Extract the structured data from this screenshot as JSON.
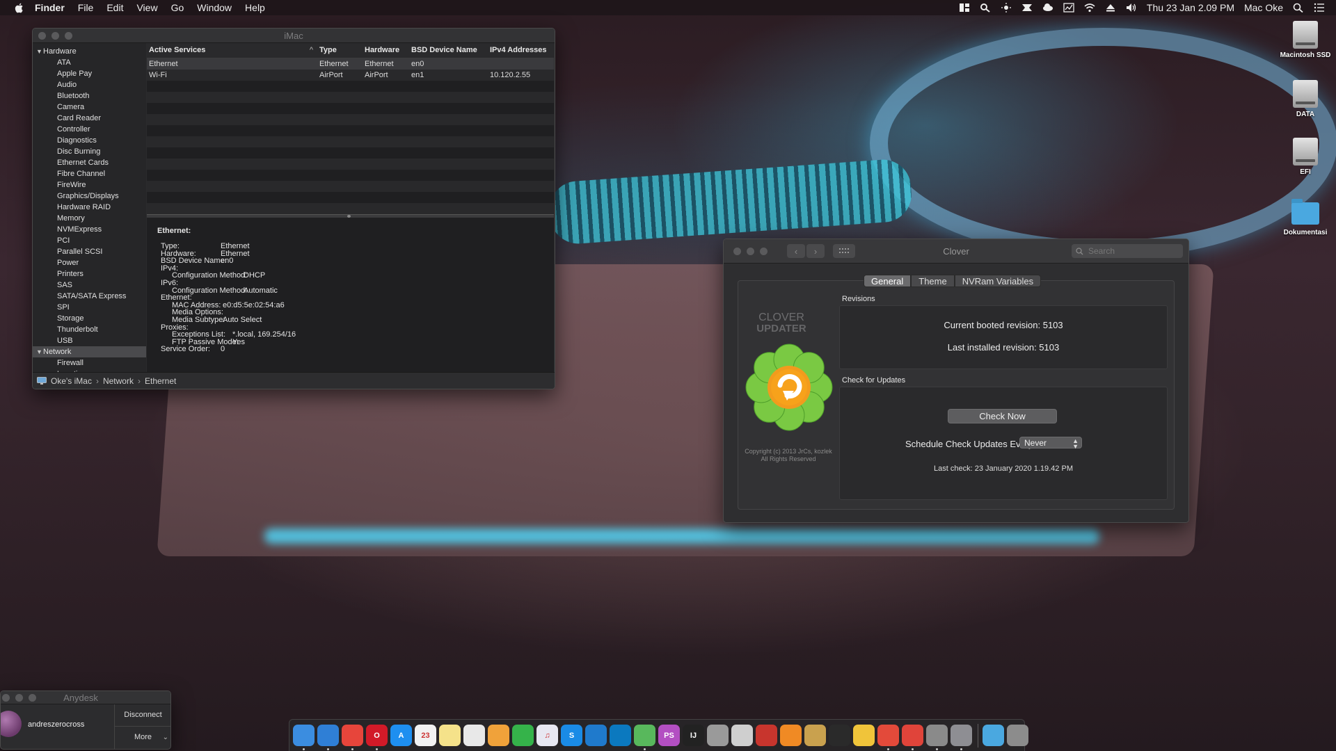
{
  "menubar": {
    "app_name": "Finder",
    "menus": [
      "File",
      "Edit",
      "View",
      "Go",
      "Window",
      "Help"
    ],
    "status_icons": [
      "layout-icon",
      "search-status-icon",
      "brightness-icon",
      "airplay-icon",
      "cloud-icon",
      "activity-icon",
      "wifi-icon",
      "eject-icon",
      "volume-icon"
    ],
    "datetime": "Thu 23 Jan  2.09 PM",
    "user": "Mac Oke",
    "right_icons": [
      "spotlight-icon",
      "notification-center-icon"
    ]
  },
  "sysinfo": {
    "title": "iMac",
    "sidebar": [
      {
        "label": "Hardware",
        "type": "cat"
      },
      {
        "label": "ATA",
        "type": "sub"
      },
      {
        "label": "Apple Pay",
        "type": "sub"
      },
      {
        "label": "Audio",
        "type": "sub"
      },
      {
        "label": "Bluetooth",
        "type": "sub"
      },
      {
        "label": "Camera",
        "type": "sub"
      },
      {
        "label": "Card Reader",
        "type": "sub"
      },
      {
        "label": "Controller",
        "type": "sub"
      },
      {
        "label": "Diagnostics",
        "type": "sub"
      },
      {
        "label": "Disc Burning",
        "type": "sub"
      },
      {
        "label": "Ethernet Cards",
        "type": "sub"
      },
      {
        "label": "Fibre Channel",
        "type": "sub"
      },
      {
        "label": "FireWire",
        "type": "sub"
      },
      {
        "label": "Graphics/Displays",
        "type": "sub"
      },
      {
        "label": "Hardware RAID",
        "type": "sub"
      },
      {
        "label": "Memory",
        "type": "sub"
      },
      {
        "label": "NVMExpress",
        "type": "sub"
      },
      {
        "label": "PCI",
        "type": "sub"
      },
      {
        "label": "Parallel SCSI",
        "type": "sub"
      },
      {
        "label": "Power",
        "type": "sub"
      },
      {
        "label": "Printers",
        "type": "sub"
      },
      {
        "label": "SAS",
        "type": "sub"
      },
      {
        "label": "SATA/SATA Express",
        "type": "sub"
      },
      {
        "label": "SPI",
        "type": "sub"
      },
      {
        "label": "Storage",
        "type": "sub"
      },
      {
        "label": "Thunderbolt",
        "type": "sub"
      },
      {
        "label": "USB",
        "type": "sub"
      },
      {
        "label": "Network",
        "type": "cat",
        "selected": true
      },
      {
        "label": "Firewall",
        "type": "sub"
      },
      {
        "label": "Locations",
        "type": "sub"
      }
    ],
    "table": {
      "columns": [
        "Active Services",
        "Type",
        "Hardware",
        "BSD Device Name",
        "IPv4 Addresses"
      ],
      "rows": [
        [
          "Ethernet",
          "Ethernet",
          "Ethernet",
          "en0",
          ""
        ],
        [
          "Wi-Fi",
          "AirPort",
          "AirPort",
          "en1",
          "10.120.2.55"
        ]
      ]
    },
    "detail": {
      "title": "Ethernet:",
      "lines": [
        {
          "label": "Type:",
          "value": "Ethernet",
          "indent": 0
        },
        {
          "label": "Hardware:",
          "value": "Ethernet",
          "indent": 0
        },
        {
          "label": "BSD Device Name:",
          "value": "en0",
          "indent": 0
        },
        {
          "label": "IPv4:",
          "value": "",
          "indent": 0
        },
        {
          "label": "Configuration Method:",
          "value": "DHCP",
          "indent": 1
        },
        {
          "label": "IPv6:",
          "value": "",
          "indent": 0
        },
        {
          "label": "Configuration Method:",
          "value": "Automatic",
          "indent": 1
        },
        {
          "label": "Ethernet:",
          "value": "",
          "indent": 0
        },
        {
          "label": "MAC Address:",
          "value": "e0:d5:5e:02:54:a6",
          "indent": 1
        },
        {
          "label": "Media Options:",
          "value": "",
          "indent": 1
        },
        {
          "label": "Media Subtype:",
          "value": "Auto Select",
          "indent": 1
        },
        {
          "label": "Proxies:",
          "value": "",
          "indent": 0
        },
        {
          "label": "Exceptions List:",
          "value": "*.local, 169.254/16",
          "indent": 1
        },
        {
          "label": "FTP Passive Mode:",
          "value": "Yes",
          "indent": 1
        },
        {
          "label": "Service Order:",
          "value": "0",
          "indent": 0
        }
      ]
    },
    "path": [
      "Oke's iMac",
      "Network",
      "Ethernet"
    ],
    "path_separator": "›"
  },
  "clover": {
    "title": "Clover",
    "search_placeholder": "Search",
    "tabs": [
      "General",
      "Theme",
      "NVRam Variables"
    ],
    "active_tab": "General",
    "logo_line1": "CLOVER",
    "logo_line2": "UPDATER",
    "copyright_line1": "Copyright (c) 2013 JrCs, kozlek",
    "copyright_line2": "All Rights Reserved",
    "revisions_label": "Revisions",
    "current_booted": "Current booted revision:  5103",
    "last_installed": "Last installed revision:  5103",
    "updates_label": "Check for Updates",
    "check_now": "Check Now",
    "schedule_label": "Schedule Check Updates Every:",
    "schedule_value": "Never",
    "last_check": "Last check: 23 January 2020 1.19.42 PM",
    "colors": {
      "flower": "#7ac943",
      "center": "#f7a21b"
    }
  },
  "desktop": {
    "icons": [
      {
        "label": "Macintosh SSD",
        "kind": "drive"
      },
      {
        "label": "DATA",
        "kind": "drive"
      },
      {
        "label": "EFI",
        "kind": "drive"
      },
      {
        "label": "Dokumentasi",
        "kind": "folder"
      }
    ]
  },
  "anydesk": {
    "title": "Anydesk",
    "user": "andreszerocross",
    "disconnect": "Disconnect",
    "more": "More"
  },
  "dock": {
    "items": [
      {
        "name": "finder-icon",
        "color": "#3b8de0",
        "glyph": "",
        "running": true
      },
      {
        "name": "safari-icon",
        "color": "#2f7fd6",
        "glyph": "",
        "running": true
      },
      {
        "name": "chrome-icon",
        "color": "#e7453b",
        "glyph": "",
        "running": true
      },
      {
        "name": "opera-icon",
        "color": "#d21a28",
        "glyph": "O",
        "running": true
      },
      {
        "name": "app-store-icon",
        "color": "#1e8ff0",
        "glyph": "A",
        "running": false
      },
      {
        "name": "calendar-icon",
        "color": "#f2f2f2",
        "glyph": "23",
        "running": false
      },
      {
        "name": "notes-icon",
        "color": "#f5e28a",
        "glyph": "",
        "running": false
      },
      {
        "name": "textedit-icon",
        "color": "#e8e8e8",
        "glyph": "",
        "running": false
      },
      {
        "name": "photos-icon",
        "color": "#f0a23a",
        "glyph": "",
        "running": false
      },
      {
        "name": "evernote-icon",
        "color": "#35b34a",
        "glyph": "",
        "running": false
      },
      {
        "name": "itunes-icon",
        "color": "#e8e8f2",
        "glyph": "♫",
        "running": false
      },
      {
        "name": "shazam-icon",
        "color": "#1a8be6",
        "glyph": "S",
        "running": false
      },
      {
        "name": "vscode-icon",
        "color": "#1f7acc",
        "glyph": "",
        "running": false
      },
      {
        "name": "trello-icon",
        "color": "#0b79bf",
        "glyph": "",
        "running": false
      },
      {
        "name": "android-studio-icon",
        "color": "#58b85c",
        "glyph": "",
        "running": true
      },
      {
        "name": "phpstorm-icon",
        "color": "#b34fc2",
        "glyph": "PS",
        "running": false
      },
      {
        "name": "intellij-icon",
        "color": "#222222",
        "glyph": "IJ",
        "running": false
      },
      {
        "name": "database-icon",
        "color": "#9a9a9a",
        "glyph": "",
        "running": false
      },
      {
        "name": "sequel-pro-icon",
        "color": "#cfcfcf",
        "glyph": "",
        "running": false
      },
      {
        "name": "photo-booth-icon",
        "color": "#c8352d",
        "glyph": "",
        "running": false
      },
      {
        "name": "mail-icon",
        "color": "#f08a24",
        "glyph": "",
        "running": false
      },
      {
        "name": "archive-icon",
        "color": "#c9a14e",
        "glyph": "",
        "running": false
      },
      {
        "name": "unity-icon",
        "color": "#2a2a2a",
        "glyph": "",
        "running": false
      },
      {
        "name": "python-icon",
        "color": "#f0c43a",
        "glyph": "",
        "running": false
      },
      {
        "name": "git-icon",
        "color": "#e34a3a",
        "glyph": "",
        "running": true
      },
      {
        "name": "sourcetree-icon",
        "color": "#e0443a",
        "glyph": "",
        "running": true
      },
      {
        "name": "keynote-icon",
        "color": "#8a8a8a",
        "glyph": "",
        "running": true
      },
      {
        "name": "system-preferences-icon",
        "color": "#8e8e93",
        "glyph": "",
        "running": true
      },
      {
        "name": "downloads-folder-icon",
        "color": "#4aa8e0",
        "glyph": "",
        "running": false
      },
      {
        "name": "trash-icon",
        "color": "#8c8c8c",
        "glyph": "",
        "running": false
      }
    ]
  }
}
